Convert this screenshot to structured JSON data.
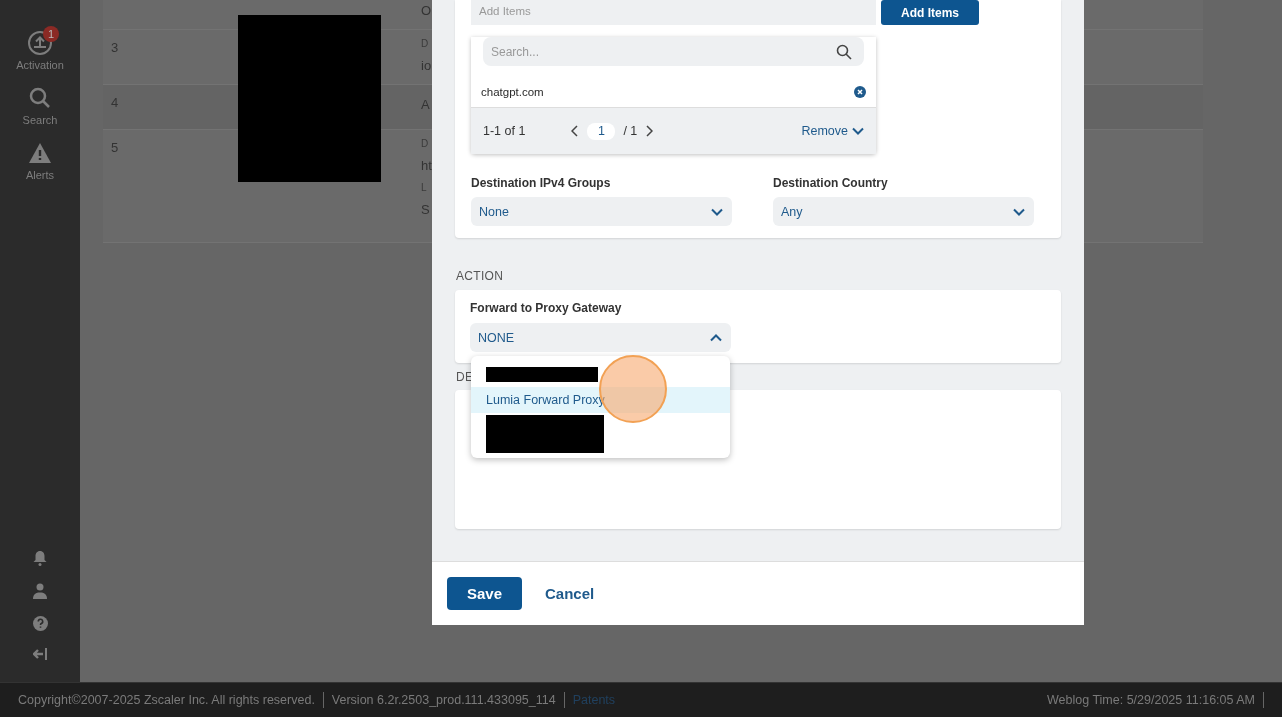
{
  "sidebar": {
    "items": [
      {
        "label": "Activation",
        "badge": "1"
      },
      {
        "label": "Search"
      },
      {
        "label": "Alerts"
      }
    ]
  },
  "background_table": {
    "rows": [
      {
        "cells": [
          {
            "kind": "value",
            "text": "O"
          }
        ]
      },
      {
        "number": "3",
        "cells": [
          {
            "kind": "label",
            "text": "D"
          },
          {
            "kind": "value",
            "text": "io"
          }
        ]
      },
      {
        "number": "4",
        "cells": [
          {
            "kind": "value",
            "text": "A"
          }
        ]
      },
      {
        "number": "5",
        "cells": [
          {
            "kind": "label",
            "text": "D"
          },
          {
            "kind": "value",
            "text": "ht"
          },
          {
            "kind": "label",
            "text": "L"
          },
          {
            "kind": "value",
            "text": "S"
          }
        ]
      }
    ]
  },
  "add_items": {
    "placeholder": "Add Items",
    "button": "Add Items",
    "search_placeholder": "Search...",
    "items": [
      {
        "label": "chatgpt.com"
      }
    ],
    "range": "1-1 of 1",
    "page": "1",
    "pages": "/ 1",
    "remove": "Remove"
  },
  "destination_fields": [
    {
      "label": "Destination IPv4 Groups",
      "value": "None"
    },
    {
      "label": "Destination Country",
      "value": "Any"
    }
  ],
  "action": {
    "heading": "ACTION",
    "label": "Forward to Proxy Gateway",
    "value": "NONE",
    "expanded": true,
    "options": [
      {
        "kind": "redacted",
        "selected": false
      },
      {
        "kind": "option",
        "label": "Lumia Forward Proxy",
        "selected": true
      },
      {
        "kind": "redacted",
        "selected": false
      }
    ]
  },
  "description": {
    "heading": "DE"
  },
  "footer_buttons": [
    {
      "kind": "primary",
      "label": "Save"
    },
    {
      "kind": "link",
      "label": "Cancel"
    }
  ],
  "status_bar": {
    "copyright": "Copyright©2007-2025 Zscaler Inc. All rights reserved.",
    "version": "Version 6.2r.2503_prod.111.433095_114",
    "link": "Patents",
    "weblog_time": "Weblog Time: 5/29/2025 11:16:05 AM"
  }
}
